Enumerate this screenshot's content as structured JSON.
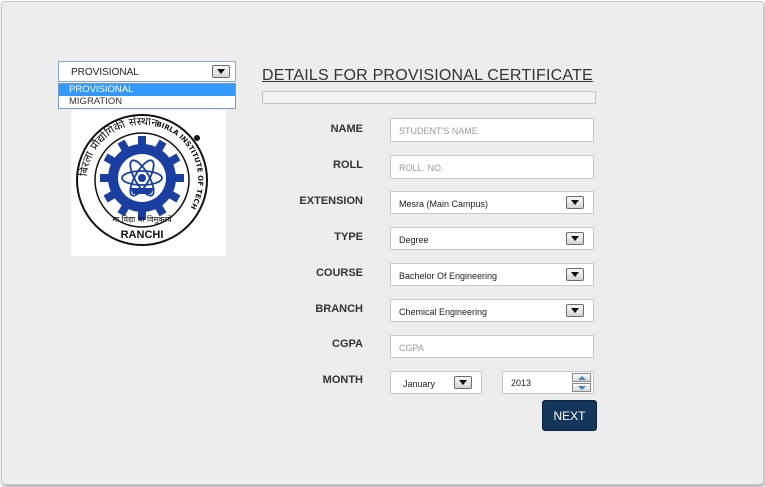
{
  "certificate_type": {
    "selected": "PROVISIONAL",
    "options": [
      "PROVISIONAL",
      "MIGRATION"
    ]
  },
  "logo": {
    "lettering_top": "बिरला प्रौद्योगिकी संस्थान",
    "lettering_right": "BIRLA INSTITUTE OF TECHNOLOGY",
    "motto": "मा विद्या या विमुक्तये",
    "place": "RANCHI"
  },
  "form": {
    "title": "DETAILS FOR PROVISIONAL CERTIFICATE",
    "name": {
      "label": "NAME",
      "placeholder": "STUDENT'S NAME"
    },
    "roll": {
      "label": "ROLL",
      "placeholder": "ROLL. NO."
    },
    "extension": {
      "label": "EXTENSION",
      "value": "Mesra (Main Campus)"
    },
    "type": {
      "label": "TYPE",
      "value": "Degree"
    },
    "course": {
      "label": "COURSE",
      "value": "Bachelor Of Engineering"
    },
    "branch": {
      "label": "BRANCH",
      "value": "Chemical Engineering"
    },
    "cgpa": {
      "label": "CGPA",
      "placeholder": "CGPA"
    },
    "month": {
      "label": "MONTH",
      "value": "January"
    },
    "year": {
      "value": "2013"
    },
    "next_label": "NEXT"
  },
  "colors": {
    "background": "#ededed",
    "button": "#14365a",
    "selection": "#3399ff",
    "logo_blue": "#1a3fa0"
  },
  "icons": {
    "dropdown": "chevron-down-icon",
    "spinner": "up-down-arrows-icon"
  }
}
